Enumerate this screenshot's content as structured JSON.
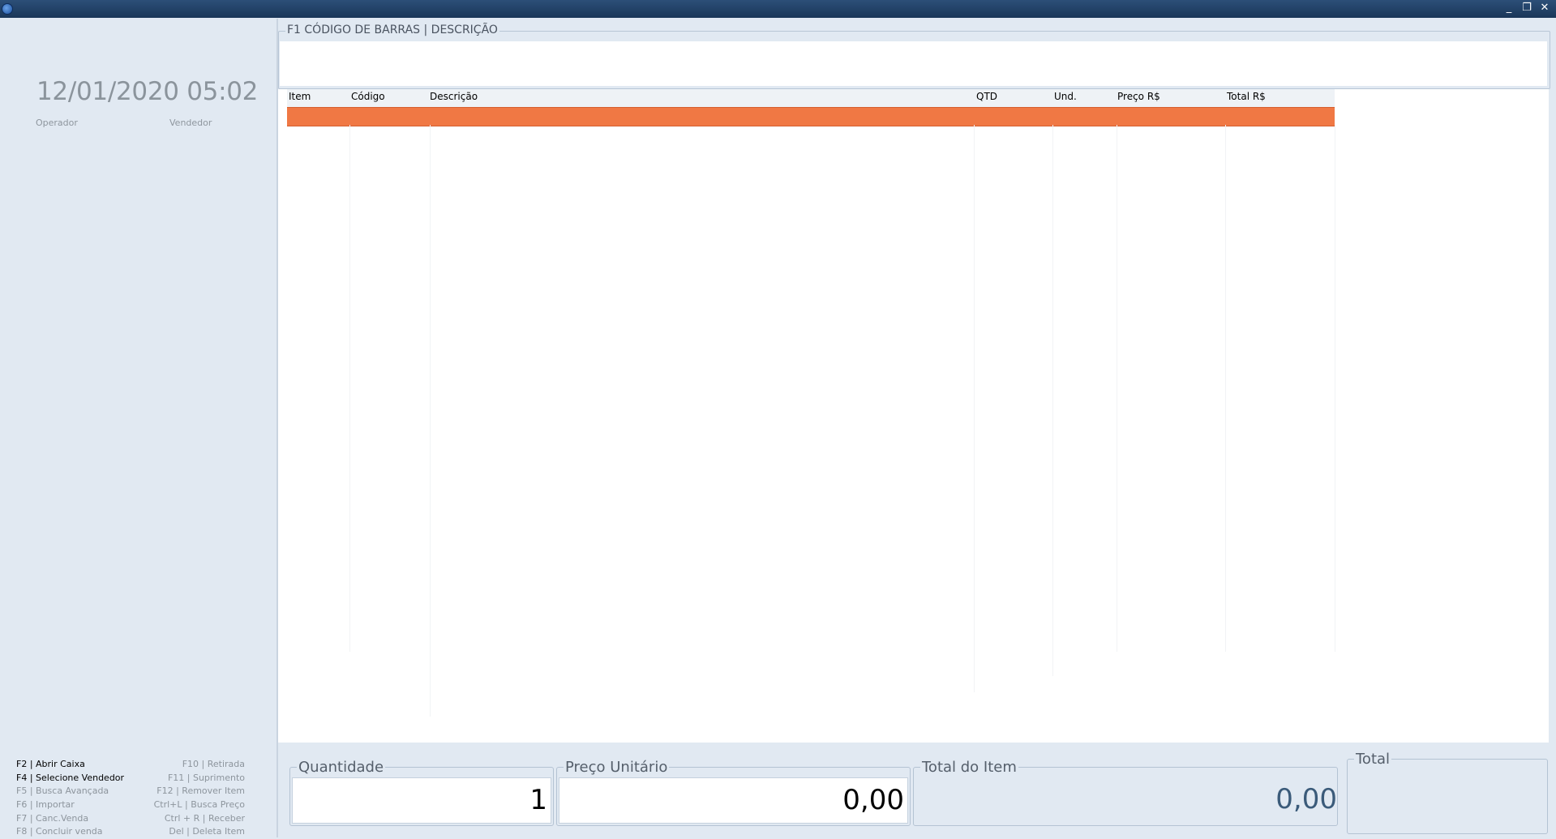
{
  "window": {
    "minimize": "_",
    "restore": "❐",
    "close": "✕"
  },
  "left": {
    "datetime": "12/01/2020 05:02",
    "operator_label": "Operador",
    "seller_label": "Vendedor"
  },
  "shortcuts": [
    {
      "left": "F2 | Abrir Caixa",
      "right": "F10 | Retirada"
    },
    {
      "left": "F4 | Selecione Vendedor",
      "right": "F11 | Suprimento"
    },
    {
      "left": "F5 | Busca Avançada",
      "right": "F12 | Remover Item"
    },
    {
      "left": "F6 | Importar",
      "right": "Ctrl+L | Busca Preço"
    },
    {
      "left": "F7 | Canc.Venda",
      "right": "Ctrl + R | Receber"
    },
    {
      "left": "F8 | Concluir venda",
      "right": "Del | Deleta Item"
    }
  ],
  "search": {
    "legend": "F1 CÓDIGO DE BARRAS | DESCRIÇÃO",
    "value": ""
  },
  "grid": {
    "columns": [
      "Item",
      "Código",
      "Descrição",
      "QTD",
      "Und.",
      "Preço R$",
      "Total R$"
    ]
  },
  "bottom": {
    "quantity_label": "Quantidade",
    "quantity_value": "1",
    "unit_price_label": "Preço Unitário",
    "unit_price_value": "0,00",
    "item_total_label": "Total do Item",
    "item_total_value": "0,00",
    "total_label": "Total",
    "total_value": ""
  },
  "colors": {
    "selected_row": "#f07844",
    "titlebar": "#1f3d63",
    "panel_bg": "#e1e9f2"
  }
}
